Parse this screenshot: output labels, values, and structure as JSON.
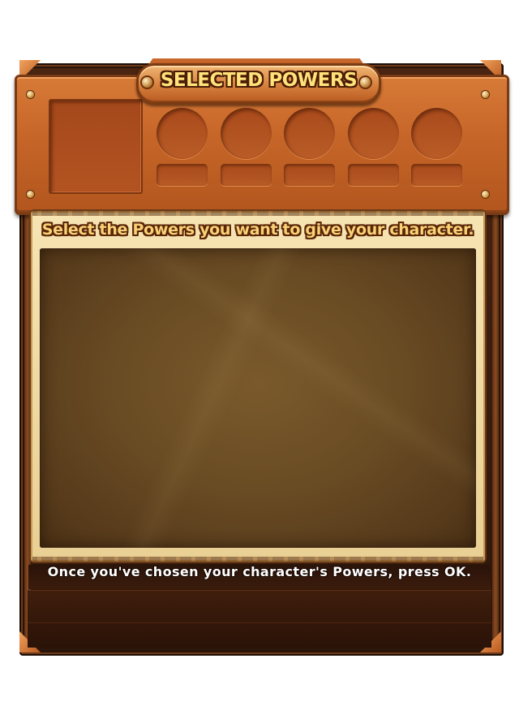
{
  "window": {
    "title": "SELECTED POWERS"
  },
  "header": {
    "portrait_slot": "character-portrait",
    "power_slots": [
      {
        "slot": 1
      },
      {
        "slot": 2
      },
      {
        "slot": 3
      },
      {
        "slot": 4
      },
      {
        "slot": 5
      }
    ]
  },
  "main": {
    "instruction": "Select the Powers you want to give your character.",
    "powers_list": []
  },
  "footer": {
    "hint": "Once you've chosen your character's Powers, press OK."
  },
  "colors": {
    "frame": "#3a1d0f",
    "header_plate": "#c66528",
    "title_text": "#ffe27a",
    "parchment": "#f0dba6",
    "list_area": "#6a4c24",
    "footer_text": "#ffffff"
  }
}
